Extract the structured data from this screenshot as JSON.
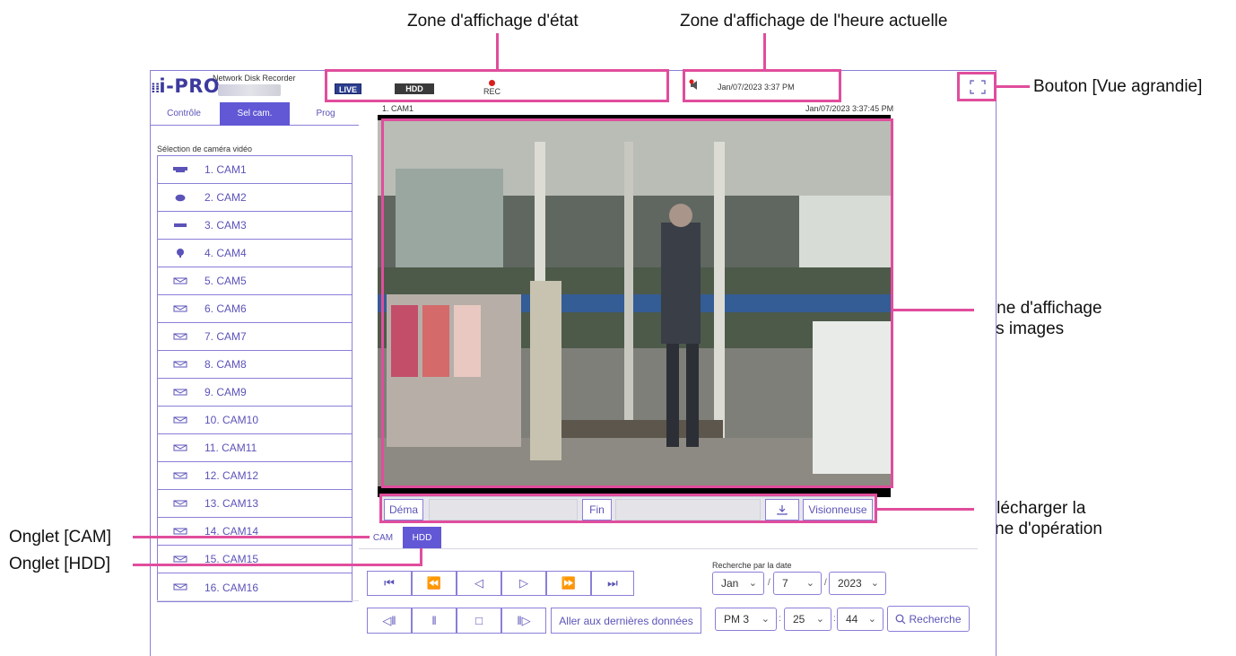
{
  "callouts": {
    "status_zone": "Zone d'affichage d'état",
    "time_zone": "Zone d'affichage de l'heure actuelle",
    "enlarge_button": "Bouton [Vue agrandie]",
    "image_zone_line1": "Zone d'affichage",
    "image_zone_line2": "des images",
    "download_zone_line1": "Télécharger la",
    "download_zone_line2": "zone d'opération",
    "cam_tab": "Onglet [CAM]",
    "hdd_tab": "Onglet [HDD]"
  },
  "header": {
    "logo": "i-PRO",
    "product": "Network Disk Recorder",
    "status_live": "LIVE",
    "status_hdd": "HDD",
    "status_rec": "REC",
    "current_time": "Jan/07/2023 3:37 PM"
  },
  "left_tabs": [
    "Contrôle",
    "Sel cam.",
    "Prog"
  ],
  "camera_section_title": "Sélection de caméra vidéo",
  "cameras": [
    {
      "label": "1. CAM1",
      "icon": "box-camera-icon"
    },
    {
      "label": "2. CAM2",
      "icon": "dome-camera-icon"
    },
    {
      "label": "3. CAM3",
      "icon": "bullet-camera-icon"
    },
    {
      "label": "4. CAM4",
      "icon": "ptz-camera-icon"
    },
    {
      "label": "5. CAM5",
      "icon": "generic-camera-icon"
    },
    {
      "label": "6. CAM6",
      "icon": "generic-camera-icon"
    },
    {
      "label": "7. CAM7",
      "icon": "generic-camera-icon"
    },
    {
      "label": "8. CAM8",
      "icon": "generic-camera-icon"
    },
    {
      "label": "9. CAM9",
      "icon": "generic-camera-icon"
    },
    {
      "label": "10. CAM10",
      "icon": "generic-camera-icon"
    },
    {
      "label": "11. CAM11",
      "icon": "generic-camera-icon"
    },
    {
      "label": "12. CAM12",
      "icon": "generic-camera-icon"
    },
    {
      "label": "13. CAM13",
      "icon": "generic-camera-icon"
    },
    {
      "label": "14. CAM14",
      "icon": "generic-camera-icon"
    },
    {
      "label": "15. CAM15",
      "icon": "generic-camera-icon"
    },
    {
      "label": "16. CAM16",
      "icon": "generic-camera-icon"
    }
  ],
  "video": {
    "camera_title": "1. CAM1",
    "timestamp": "Jan/07/2023 3:37:45 PM"
  },
  "download": {
    "start_label": "Déma",
    "end_label": "Fin",
    "viewer_label": "Visionneuse"
  },
  "playback_tabs": [
    "CAM",
    "HDD"
  ],
  "controls": {
    "goto_latest": "Aller aux dernières données"
  },
  "date_search": {
    "title": "Recherche par la date",
    "month": "Jan",
    "day": "7",
    "year": "2023",
    "hour": "PM 3",
    "minute": "25",
    "second": "44",
    "search_label": "Recherche",
    "separator_date": "/",
    "separator_time": ":"
  },
  "colors": {
    "accent": "#6258d6",
    "callout": "#e04d9c",
    "live_badge": "#2c3e8f",
    "hdd_badge": "#3a3a3a",
    "rec_dot": "#d81e1e"
  }
}
